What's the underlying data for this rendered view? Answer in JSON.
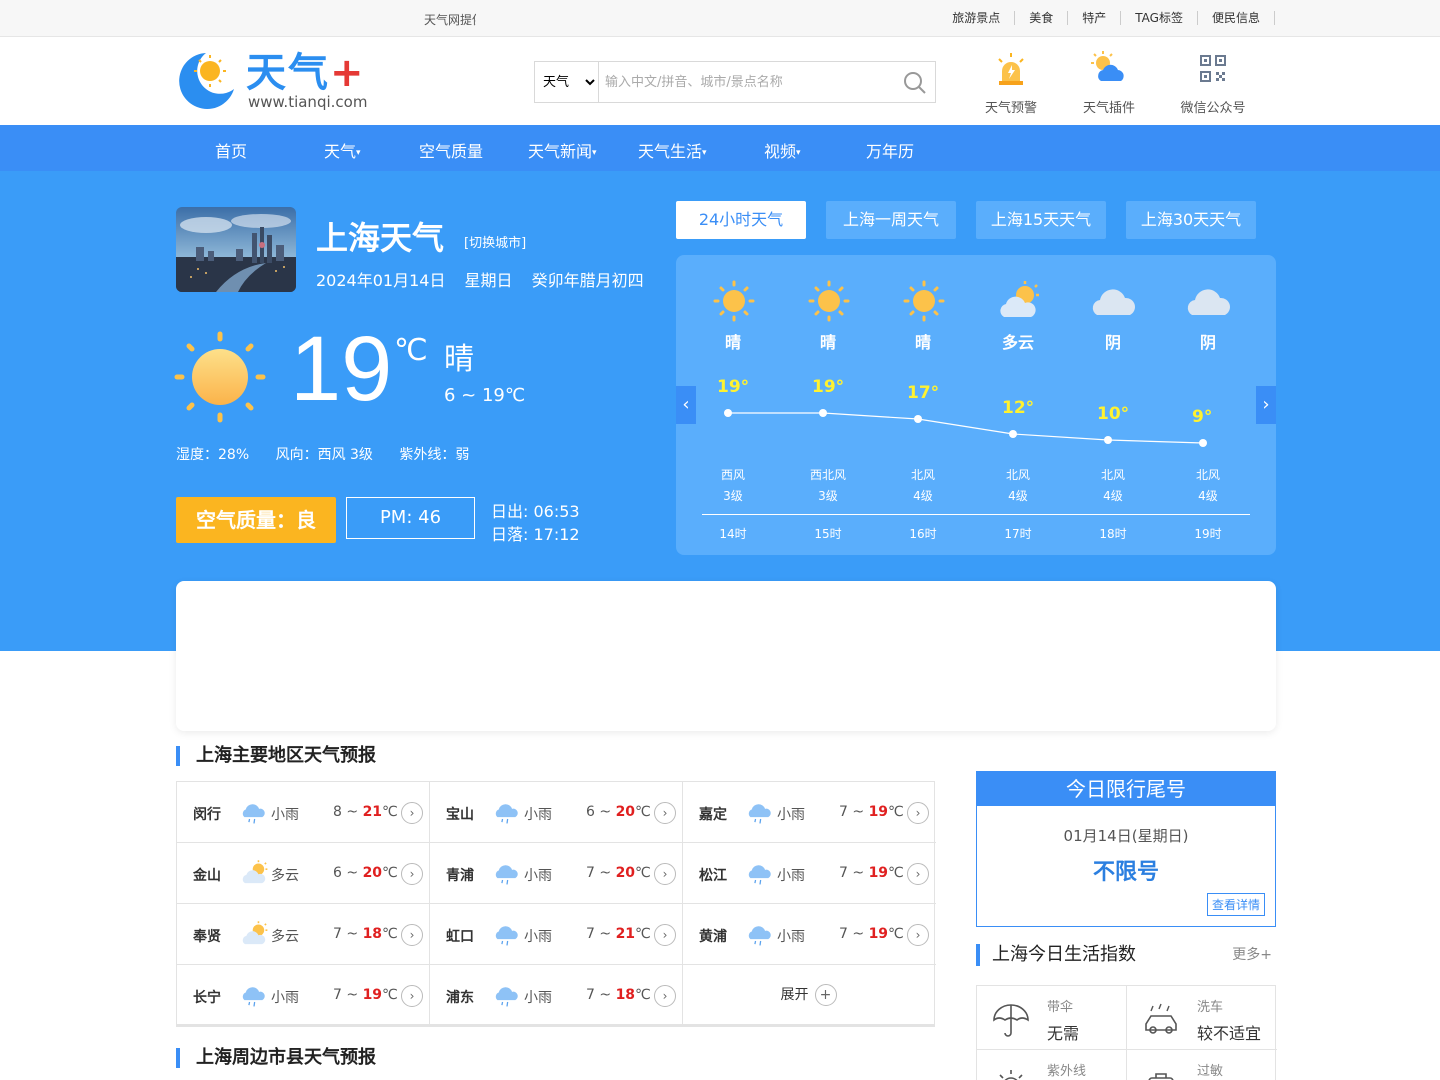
{
  "topbar": {
    "notice": "天气网提供",
    "links": [
      "旅游景点",
      "美食",
      "特产",
      "TAG标签",
      "便民信息"
    ]
  },
  "header": {
    "brand": "天气",
    "brand_plus": "+",
    "url": "www.tianqi.com",
    "search_select": "天气",
    "search_placeholder": "输入中文/拼音、城市/景点名称",
    "tools": [
      {
        "label": "天气预警",
        "icon": "alert-icon"
      },
      {
        "label": "天气插件",
        "icon": "plugin-icon"
      },
      {
        "label": "微信公众号",
        "icon": "qrcode-icon"
      }
    ]
  },
  "nav": [
    {
      "label": "首页",
      "caret": ""
    },
    {
      "label": "天气",
      "caret": "▾"
    },
    {
      "label": "空气质量",
      "caret": ""
    },
    {
      "label": "天气新闻",
      "caret": "▾"
    },
    {
      "label": "天气生活",
      "caret": "▾"
    },
    {
      "label": "视频",
      "caret": "▾"
    },
    {
      "label": "万年历",
      "caret": ""
    }
  ],
  "current": {
    "city": "上海天气",
    "switch": "[切换城市]",
    "date": "2024年01月14日",
    "weekday": "星期日",
    "lunar": "癸卯年腊月初四",
    "temp": "19",
    "unit": "℃",
    "condition": "晴",
    "range": "6 ~ 19℃",
    "humidity": "湿度：28%",
    "wind": "风向：西风 3级",
    "uv": "紫外线：弱",
    "aqi": "空气质量：良",
    "pm": "PM: 46",
    "sunrise": "日出: 06:53",
    "sunset": "日落: 17:12"
  },
  "tabs": [
    "24小时天气",
    "上海一周天气",
    "上海15天天气",
    "上海30天天气"
  ],
  "hourly": [
    {
      "hour": "14时",
      "cond": "晴",
      "temp": 19,
      "temp_label": "19°",
      "wind_dir": "西风",
      "wind_lv": "3级",
      "icon": "sun"
    },
    {
      "hour": "15时",
      "cond": "晴",
      "temp": 19,
      "temp_label": "19°",
      "wind_dir": "西北风",
      "wind_lv": "3级",
      "icon": "sun"
    },
    {
      "hour": "16时",
      "cond": "晴",
      "temp": 17,
      "temp_label": "17°",
      "wind_dir": "北风",
      "wind_lv": "4级",
      "icon": "sun"
    },
    {
      "hour": "17时",
      "cond": "多云",
      "temp": 12,
      "temp_label": "12°",
      "wind_dir": "北风",
      "wind_lv": "4级",
      "icon": "partly"
    },
    {
      "hour": "18时",
      "cond": "阴",
      "temp": 10,
      "temp_label": "10°",
      "wind_dir": "北风",
      "wind_lv": "4级",
      "icon": "cloud"
    },
    {
      "hour": "19时",
      "cond": "阴",
      "temp": 9,
      "temp_label": "9°",
      "wind_dir": "北风",
      "wind_lv": "4级",
      "icon": "cloud"
    }
  ],
  "regions_title": "上海主要地区天气预报",
  "regions": [
    {
      "name": "闵行",
      "cond": "小雨",
      "lo": "8",
      "hi": "21",
      "icon": "rain"
    },
    {
      "name": "宝山",
      "cond": "小雨",
      "lo": "6",
      "hi": "20",
      "icon": "rain"
    },
    {
      "name": "嘉定",
      "cond": "小雨",
      "lo": "7",
      "hi": "19",
      "icon": "rain"
    },
    {
      "name": "金山",
      "cond": "多云",
      "lo": "6",
      "hi": "20",
      "icon": "partly"
    },
    {
      "name": "青浦",
      "cond": "小雨",
      "lo": "7",
      "hi": "20",
      "icon": "rain"
    },
    {
      "name": "松江",
      "cond": "小雨",
      "lo": "7",
      "hi": "19",
      "icon": "rain"
    },
    {
      "name": "奉贤",
      "cond": "多云",
      "lo": "7",
      "hi": "18",
      "icon": "partly"
    },
    {
      "name": "虹口",
      "cond": "小雨",
      "lo": "7",
      "hi": "21",
      "icon": "rain"
    },
    {
      "name": "黄浦",
      "cond": "小雨",
      "lo": "7",
      "hi": "19",
      "icon": "rain"
    },
    {
      "name": "长宁",
      "cond": "小雨",
      "lo": "7",
      "hi": "19",
      "icon": "rain"
    },
    {
      "name": "浦东",
      "cond": "小雨",
      "lo": "7",
      "hi": "18",
      "icon": "rain"
    }
  ],
  "range_sep": " ~ ",
  "deg": "℃",
  "go": "›",
  "expand": "展开",
  "expand_plus": "+",
  "nearby_title": "上海周边市县天气预报",
  "limit": {
    "title": "今日限行尾号",
    "date": "01月14日(星期日)",
    "value": "不限号",
    "button": "查看详情"
  },
  "life": {
    "title": "上海今日生活指数",
    "more": "更多+",
    "items": [
      {
        "name": "带伞",
        "value": "无需",
        "icon": "umbrella-icon"
      },
      {
        "name": "洗车",
        "value": "较不适宜",
        "icon": "car-wash-icon"
      },
      {
        "name": "紫外线",
        "value": "",
        "icon": "uv-icon"
      },
      {
        "name": "过敏",
        "value": "",
        "icon": "allergy-icon"
      }
    ]
  },
  "colors": {
    "accent": "#3a8ef6",
    "hero": "#3a9cf8",
    "aqi": "#fbb520",
    "hot": "#e02020",
    "hourly_temp": "#fff230"
  }
}
